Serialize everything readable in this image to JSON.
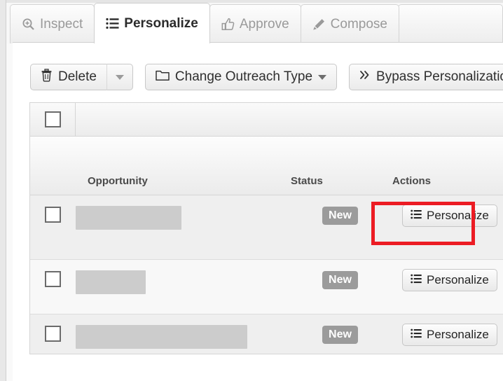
{
  "tabs": [
    {
      "label": "Inspect",
      "icon": "magnifier-plus-icon",
      "active": false
    },
    {
      "label": "Personalize",
      "icon": "list-icon",
      "active": true
    },
    {
      "label": "Approve",
      "icon": "thumbs-up-icon",
      "active": false
    },
    {
      "label": "Compose",
      "icon": "pencil-icon",
      "active": false
    }
  ],
  "toolbar": {
    "delete_label": "Delete",
    "delete_icon": "trash-icon",
    "change_outreach_label": "Change Outreach Type",
    "change_outreach_icon": "folder-icon",
    "bypass_label": "Bypass Personalization",
    "bypass_icon": "double-chevron-right-icon"
  },
  "grid": {
    "select_all_checked": false,
    "columns": [
      "Opportunity",
      "Status",
      "Actions"
    ],
    "action_label": "Personalize",
    "action_icon": "list-icon",
    "rows": [
      {
        "opportunity": "",
        "redacted_width": 151,
        "status": "New",
        "action": "Personalize",
        "checked": false,
        "highlighted": true
      },
      {
        "opportunity": "",
        "redacted_width": 100,
        "status": "New",
        "action": "Personalize",
        "checked": false,
        "highlighted": false
      },
      {
        "opportunity": "",
        "redacted_width": 245,
        "status": "New",
        "action": "Personalize",
        "checked": false,
        "highlighted": false
      }
    ]
  },
  "colors": {
    "highlight": "#ec1c24",
    "badge": "#9b9b9b",
    "redaction": "#cccccc",
    "active_tab_text": "#2b2b2b",
    "inactive_tab_text": "#9a9a9a"
  }
}
